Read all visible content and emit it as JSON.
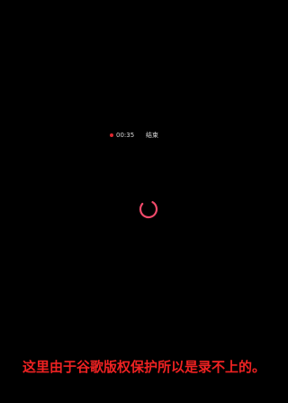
{
  "recording": {
    "time": "00:35",
    "stop_label": "结束",
    "indicator_color": "#e0272f"
  },
  "loading": {
    "icon": "loading-spinner-icon",
    "color": "#f04a6a"
  },
  "caption": {
    "text": "这里由于谷歌版权保护所以是录不上的。",
    "color": "#ee2222"
  }
}
